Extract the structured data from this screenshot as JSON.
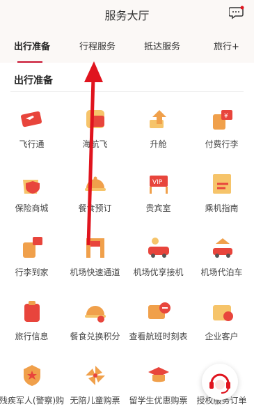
{
  "header": {
    "title": "服务大厅",
    "message_icon": "message-icon"
  },
  "tabs": [
    {
      "label": "出行准备",
      "active": true
    },
    {
      "label": "行程服务",
      "active": false
    },
    {
      "label": "抵达服务",
      "active": false
    },
    {
      "label": "旅行+",
      "active": false
    }
  ],
  "section": {
    "title": "出行准备"
  },
  "services": [
    {
      "label": "飞行通",
      "icon": "ticket-plane-icon"
    },
    {
      "label": "海航飞",
      "icon": "plane-card-icon"
    },
    {
      "label": "升舱",
      "icon": "upgrade-icon"
    },
    {
      "label": "付费行李",
      "icon": "paid-luggage-icon"
    },
    {
      "label": "保险商城",
      "icon": "insurance-bag-icon"
    },
    {
      "label": "餐食预订",
      "icon": "meal-cloche-icon"
    },
    {
      "label": "贵宾室",
      "icon": "vip-lounge-icon"
    },
    {
      "label": "乘机指南",
      "icon": "boarding-guide-icon"
    },
    {
      "label": "行李到家",
      "icon": "luggage-home-icon"
    },
    {
      "label": "机场快速通道",
      "icon": "fast-lane-icon"
    },
    {
      "label": "机场优享接机",
      "icon": "car-pickup-icon"
    },
    {
      "label": "机场代泊车",
      "icon": "valet-parking-icon"
    },
    {
      "label": "旅行信息",
      "icon": "travel-info-icon"
    },
    {
      "label": "餐食兑换积分",
      "icon": "meal-points-icon"
    },
    {
      "label": "查看航班时刻表",
      "icon": "flight-schedule-icon"
    },
    {
      "label": "企业客户",
      "icon": "corporate-client-icon"
    },
    {
      "label": "残疾军人(警察)购",
      "icon": "military-badge-icon"
    },
    {
      "label": "无陪儿童购票",
      "icon": "pinwheel-icon"
    },
    {
      "label": "留学生优惠购票",
      "icon": "graduate-cap-icon"
    },
    {
      "label": "授权服务订单",
      "icon": "service-order-icon"
    }
  ],
  "floating": {
    "icon": "customer-service-icon"
  },
  "colors": {
    "accent": "#c8102e",
    "icon_orange": "#f0a04b",
    "icon_red": "#e8453c",
    "arrow": "#e0141e"
  }
}
